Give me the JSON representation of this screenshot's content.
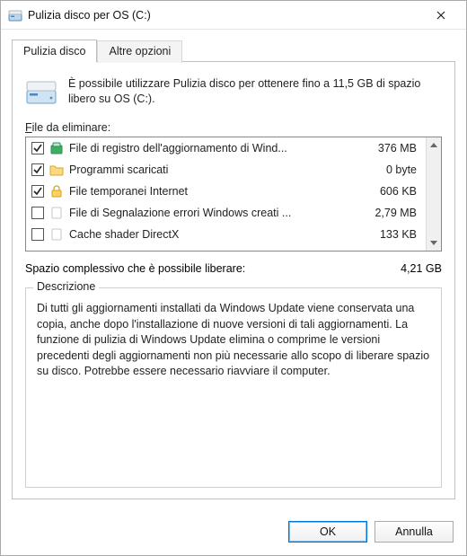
{
  "titlebar": {
    "title": "Pulizia disco per OS (C:)"
  },
  "tabs": {
    "active": "Pulizia disco",
    "inactive": "Altre opzioni"
  },
  "intro": "È possibile utilizzare Pulizia disco per ottenere fino a 11,5 GB di spazio libero su OS (C:).",
  "files_label_pre": "F",
  "files_label_rest": "ile da eliminare:",
  "files": [
    {
      "checked": true,
      "icon": "log",
      "name": "File di registro dell'aggiornamento di Wind...",
      "size": "376 MB"
    },
    {
      "checked": true,
      "icon": "folder",
      "name": "Programmi scaricati",
      "size": "0 byte"
    },
    {
      "checked": true,
      "icon": "lock",
      "name": "File temporanei Internet",
      "size": "606 KB"
    },
    {
      "checked": false,
      "icon": "blank",
      "name": "File di Segnalazione errori Windows creati ...",
      "size": "2,79 MB"
    },
    {
      "checked": false,
      "icon": "blank",
      "name": "Cache shader DirectX",
      "size": "133 KB"
    }
  ],
  "total": {
    "label": "Spazio complessivo che è possibile liberare:",
    "value": "4,21 GB"
  },
  "description": {
    "legend": "Descrizione",
    "text": "Di tutti gli aggiornamenti installati da Windows Update viene conservata una copia, anche dopo l'installazione di nuove versioni di tali aggiornamenti. La funzione di pulizia di Windows Update elimina o comprime le versioni precedenti degli aggiornamenti non più necessarie allo scopo di liberare spazio su disco. Potrebbe essere necessario riavviare il computer."
  },
  "buttons": {
    "ok": "OK",
    "cancel": "Annulla"
  }
}
